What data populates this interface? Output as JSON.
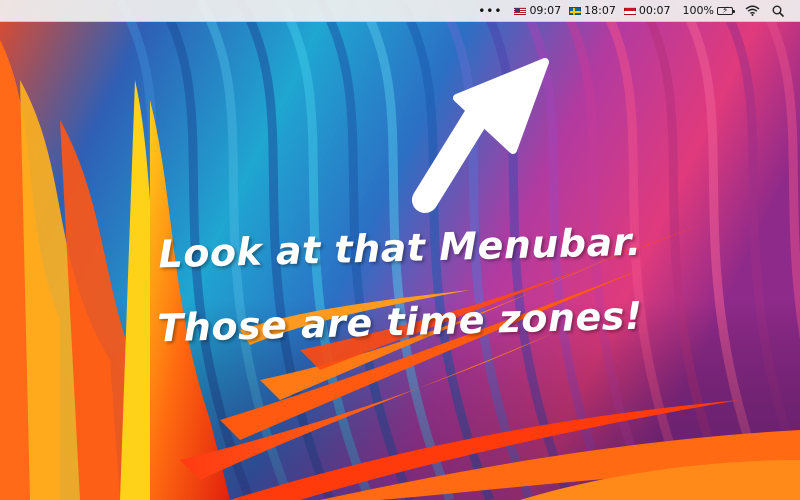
{
  "menubar": {
    "more_label": "•••",
    "clocks": [
      {
        "flag": "us-flag-icon",
        "time": "09:07"
      },
      {
        "flag": "sweden-flag-icon",
        "time": "18:07"
      },
      {
        "flag": "indonesia-flag-icon",
        "time": "00:07"
      }
    ],
    "battery_percent": "100%",
    "icons": [
      "battery-charging-icon",
      "wifi-icon",
      "search-icon"
    ]
  },
  "caption": {
    "line1": "Look at that Menubar.",
    "line2": "Those are time zones!"
  },
  "colors": {
    "arrow": "#ffffff",
    "caption": "#ffffff",
    "menubar": "#eeeeee"
  }
}
